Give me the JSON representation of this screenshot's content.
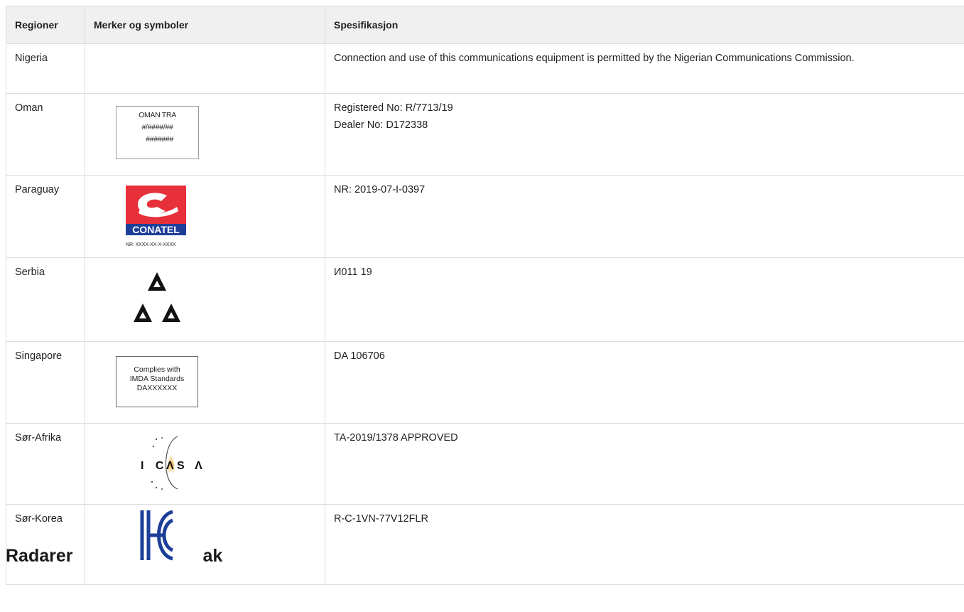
{
  "headers": {
    "region": "Regioner",
    "marks": "Merker og symboler",
    "spec": "Spesifikasjon"
  },
  "rows": [
    {
      "region": "Nigeria",
      "spec_lines": [
        "Connection and use of this communications equipment is permitted by the Nigerian Communications Commission."
      ]
    },
    {
      "region": "Oman",
      "spec_lines": [
        "Registered No: R/7713/19",
        "Dealer No: D172338"
      ],
      "mark": {
        "icon": "oman-tra-label",
        "lines": [
          "OMAN TRA",
          "#/####/##",
          "#######"
        ]
      }
    },
    {
      "region": "Paraguay",
      "spec_lines": [
        "NR: 2019-07-I-0397"
      ],
      "mark": {
        "icon": "conatel-logo",
        "logo_text": "CONATEL",
        "caption": "NR: XXXX-XX-X-XXXX",
        "color_red": "#e8303a",
        "color_blue": "#1d3f99"
      }
    },
    {
      "region": "Serbia",
      "spec_lines": [
        "И011 19"
      ],
      "mark": {
        "icon": "serbia-triangle-a-mark"
      }
    },
    {
      "region": "Singapore",
      "spec_lines": [
        "DA 106706"
      ],
      "mark": {
        "icon": "imda-label",
        "lines": [
          "Complies with",
          "IMDA Standards",
          "DAXXXXXX"
        ]
      }
    },
    {
      "region": "Sør-Afrika",
      "spec_lines": [
        "TA-2019/1378 APPROVED"
      ],
      "mark": {
        "icon": "icasa-logo",
        "logo_text": "ICASA"
      }
    },
    {
      "region": "Sør-Korea",
      "spec_lines": [
        "R-C-1VN-77V12FLR"
      ],
      "mark": {
        "icon": "kc-logo",
        "color": "#1d3f99"
      }
    }
  ],
  "overlap_heading": {
    "visible_text": "Radarer",
    "visible_tail": "ak"
  }
}
